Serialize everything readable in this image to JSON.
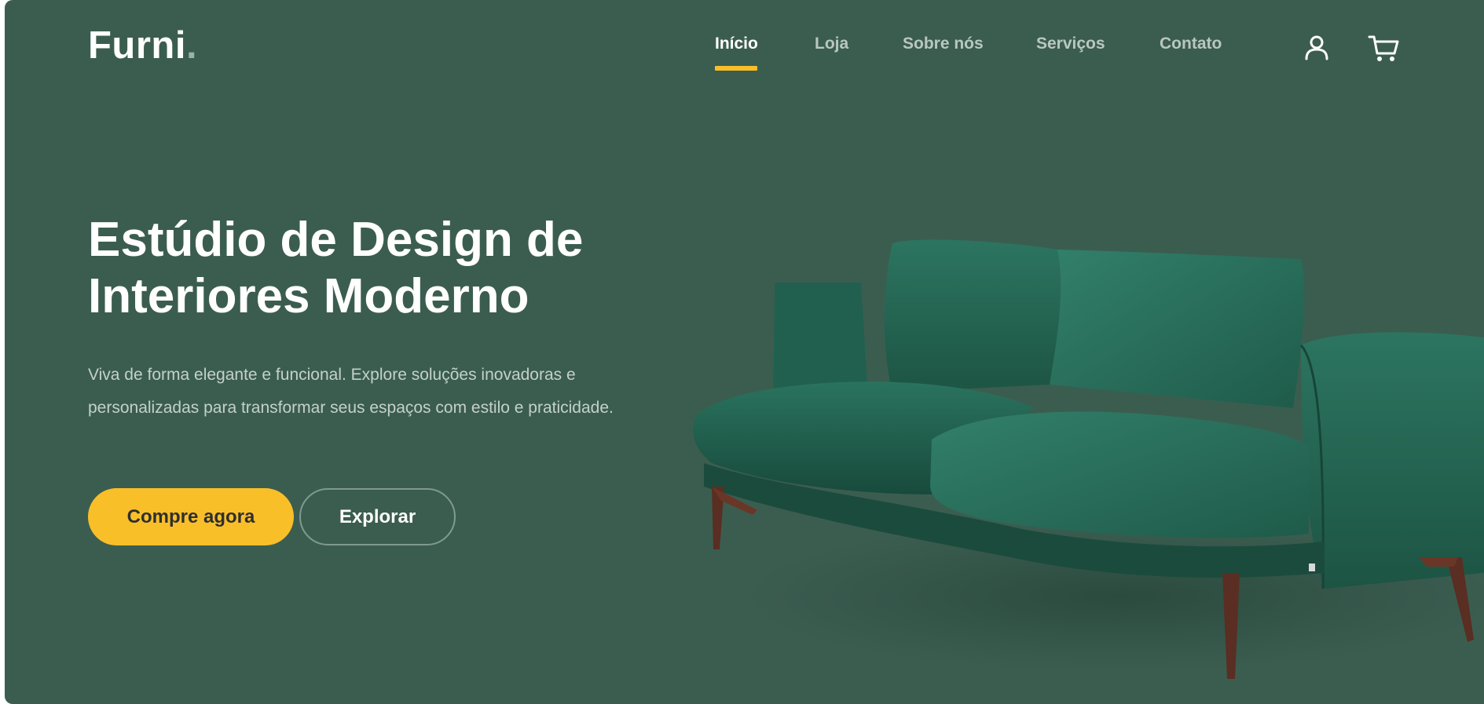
{
  "brand": {
    "name": "Furni",
    "dot": "."
  },
  "nav": {
    "items": [
      {
        "label": "Início",
        "active": true
      },
      {
        "label": "Loja",
        "active": false
      },
      {
        "label": "Sobre nós",
        "active": false
      },
      {
        "label": "Serviços",
        "active": false
      },
      {
        "label": "Contato",
        "active": false
      }
    ],
    "icons": [
      "user-icon",
      "cart-icon"
    ]
  },
  "hero": {
    "title_line1": "Estúdio de Design de",
    "title_line2": "Interiores Moderno",
    "description": "Viva de forma elegante e funcional. Explore soluções inovadoras e personalizadas para transformar seus espaços com estilo e praticidade.",
    "primary_button": "Compre agora",
    "secondary_button": "Explorar"
  },
  "colors": {
    "background": "#3b5d50",
    "accent": "#f9bf29",
    "text": "#ffffff",
    "muted_text": "#c3d1ca",
    "sofa": "#2f6b58"
  },
  "image": {
    "subject": "sofa-image"
  }
}
